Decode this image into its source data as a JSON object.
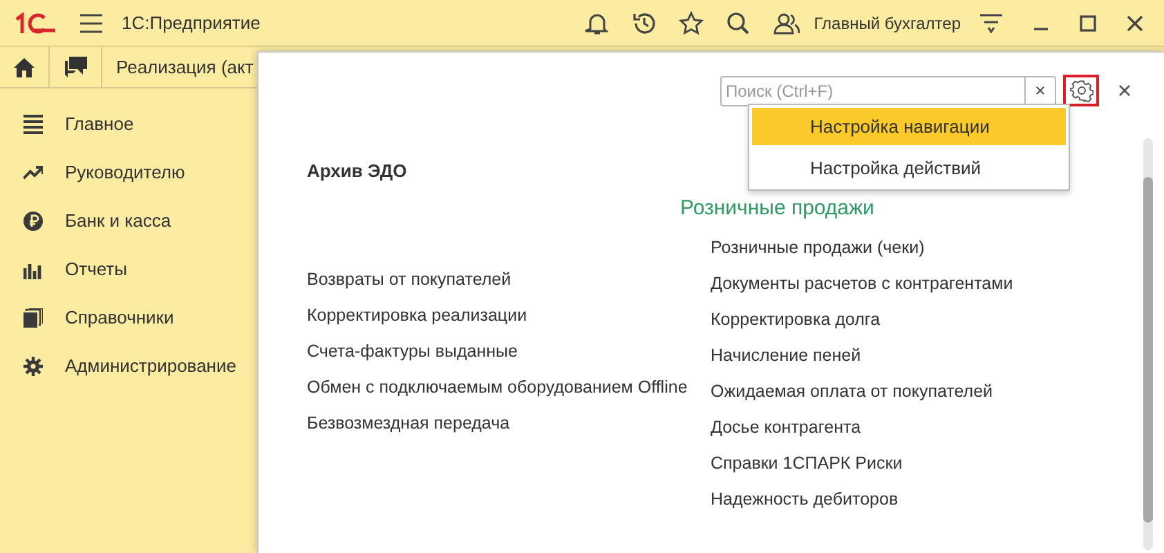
{
  "app": {
    "title": "1С:Предприятие",
    "user": "Главный бухгалтер"
  },
  "open_tab": {
    "label": "Реализация (акт"
  },
  "sidebar": {
    "items": [
      {
        "label": "Главное"
      },
      {
        "label": "Руководителю"
      },
      {
        "label": "Банк и касса"
      },
      {
        "label": "Отчеты"
      },
      {
        "label": "Справочники"
      },
      {
        "label": "Администрирование"
      }
    ]
  },
  "panel": {
    "search": {
      "placeholder": "Поиск (Ctrl+F)"
    },
    "settings_menu": [
      {
        "label": "Настройка навигации",
        "selected": true
      },
      {
        "label": "Настройка действий",
        "selected": false
      }
    ],
    "columns": [
      {
        "heading": "Архив ЭДО",
        "kind": "plain",
        "items": [
          "Возвраты от покупателей",
          "Корректировка реализации",
          "Счета-фактуры выданные",
          "Обмен с подключаемым оборудованием Offline",
          "Безвозмездная передача"
        ]
      },
      {
        "heading": "Розничные продажи",
        "kind": "group",
        "items": [
          "Розничные продажи (чеки)",
          "Документы расчетов с контрагентами",
          "Корректировка долга",
          "Начисление пеней",
          "Ожидаемая оплата от покупателей",
          "Досье контрагента",
          "Справки 1СПАРК Риски",
          "Надежность дебиторов"
        ]
      }
    ]
  }
}
